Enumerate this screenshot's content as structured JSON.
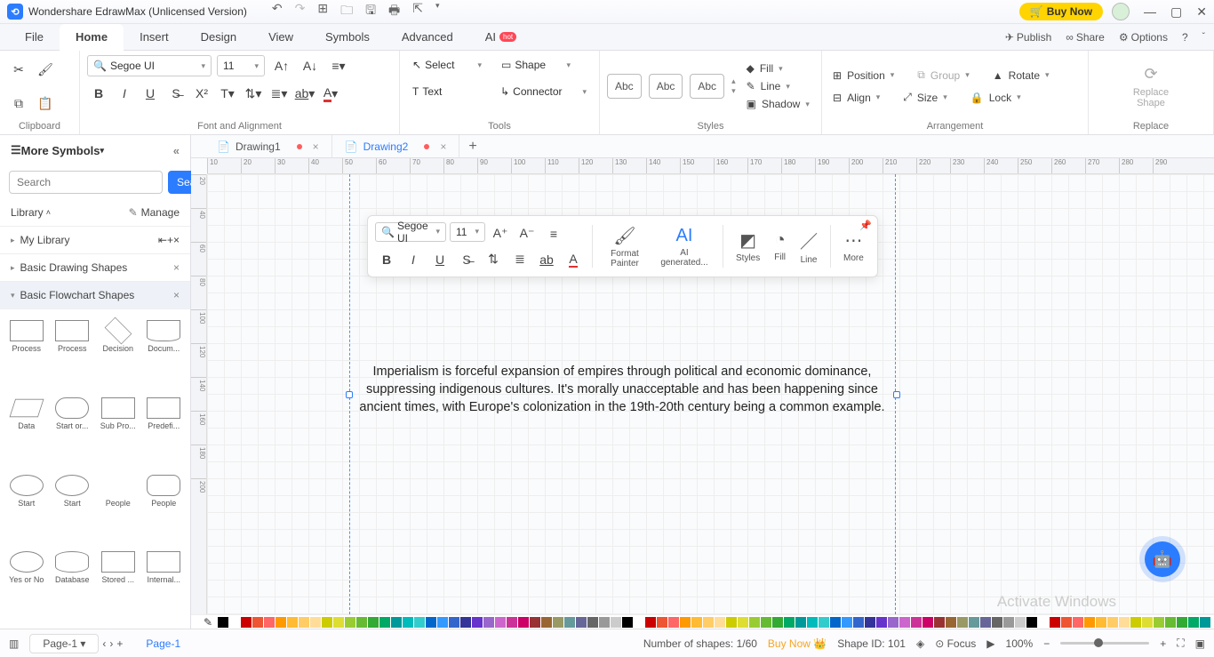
{
  "app": {
    "title": "Wondershare EdrawMax (Unlicensed Version)",
    "buy": "Buy Now"
  },
  "menu": {
    "file": "File",
    "home": "Home",
    "insert": "Insert",
    "design": "Design",
    "view": "View",
    "symbols": "Symbols",
    "advanced": "Advanced",
    "ai": "AI",
    "hot": "hot",
    "publish": "Publish",
    "share": "Share",
    "options": "Options"
  },
  "ribbon": {
    "clipboard": "Clipboard",
    "fontAlign": "Font and Alignment",
    "tools": "Tools",
    "styles": "Styles",
    "arrangement": "Arrangement",
    "replace": "Replace",
    "font": "Segoe UI",
    "size": "11",
    "select": "Select",
    "shape": "Shape",
    "text": "Text",
    "connector": "Connector",
    "abc": "Abc",
    "fill": "Fill",
    "line": "Line",
    "shadow": "Shadow",
    "position": "Position",
    "align": "Align",
    "group": "Group",
    "sizeBtn": "Size",
    "rotate": "Rotate",
    "lock": "Lock",
    "replaceShape": "Replace\nShape"
  },
  "docTabs": {
    "d1": "Drawing1",
    "d2": "Drawing2"
  },
  "side": {
    "more": "More Symbols",
    "searchPH": "Search",
    "searchBtn": "Search",
    "library": "Library",
    "manage": "Manage",
    "mylib": "My Library",
    "basic": "Basic Drawing Shapes",
    "flow": "Basic Flowchart Shapes",
    "shapes": [
      "Process",
      "Process",
      "Decision",
      "Docum...",
      "Data",
      "Start or...",
      "Sub Pro...",
      "Predefi...",
      "Start",
      "Start",
      "People",
      "People",
      "Yes or No",
      "Database",
      "Stored ...",
      "Internal..."
    ]
  },
  "float": {
    "font": "Segoe UI",
    "size": "11",
    "format": "Format Painter",
    "ai": "AI generated...",
    "styles": "Styles",
    "fill": "Fill",
    "line": "Line",
    "more": "More"
  },
  "canvas": {
    "text": "Imperialism is forceful expansion of empires through political and economic dominance, suppressing indigenous cultures. It's morally unacceptable and has been happening since ancient times, with Europe's colonization in the 19th-20th century being a common example.",
    "hticks": [
      "10",
      "20",
      "30",
      "40",
      "50",
      "60",
      "70",
      "80",
      "90",
      "100",
      "110",
      "120",
      "130",
      "140",
      "150",
      "160",
      "170",
      "180",
      "190",
      "200",
      "210",
      "220",
      "230",
      "240",
      "250",
      "260",
      "270",
      "280",
      "290"
    ],
    "vticks": [
      "20",
      "40",
      "60",
      "80",
      "100",
      "120",
      "140",
      "160",
      "180",
      "200"
    ]
  },
  "status": {
    "page": "Page-1",
    "page2": "Page-1",
    "shapes": "Number of shapes: 1/60",
    "buy": "Buy Now",
    "shapeid": "Shape ID: 101",
    "focus": "Focus",
    "zoom": "100%"
  },
  "watermark": "Activate Windows",
  "colors": [
    "#000",
    "#fff",
    "#c00",
    "#e53",
    "#f66",
    "#f90",
    "#fb3",
    "#fc6",
    "#fd9",
    "#cc0",
    "#dd3",
    "#9c3",
    "#6b3",
    "#3a3",
    "#0a6",
    "#099",
    "#0bb",
    "#3cc",
    "#06c",
    "#39f",
    "#36c",
    "#339",
    "#63c",
    "#96c",
    "#c6c",
    "#c39",
    "#c06",
    "#933",
    "#963",
    "#996",
    "#699",
    "#669",
    "#666",
    "#999",
    "#ccc"
  ]
}
